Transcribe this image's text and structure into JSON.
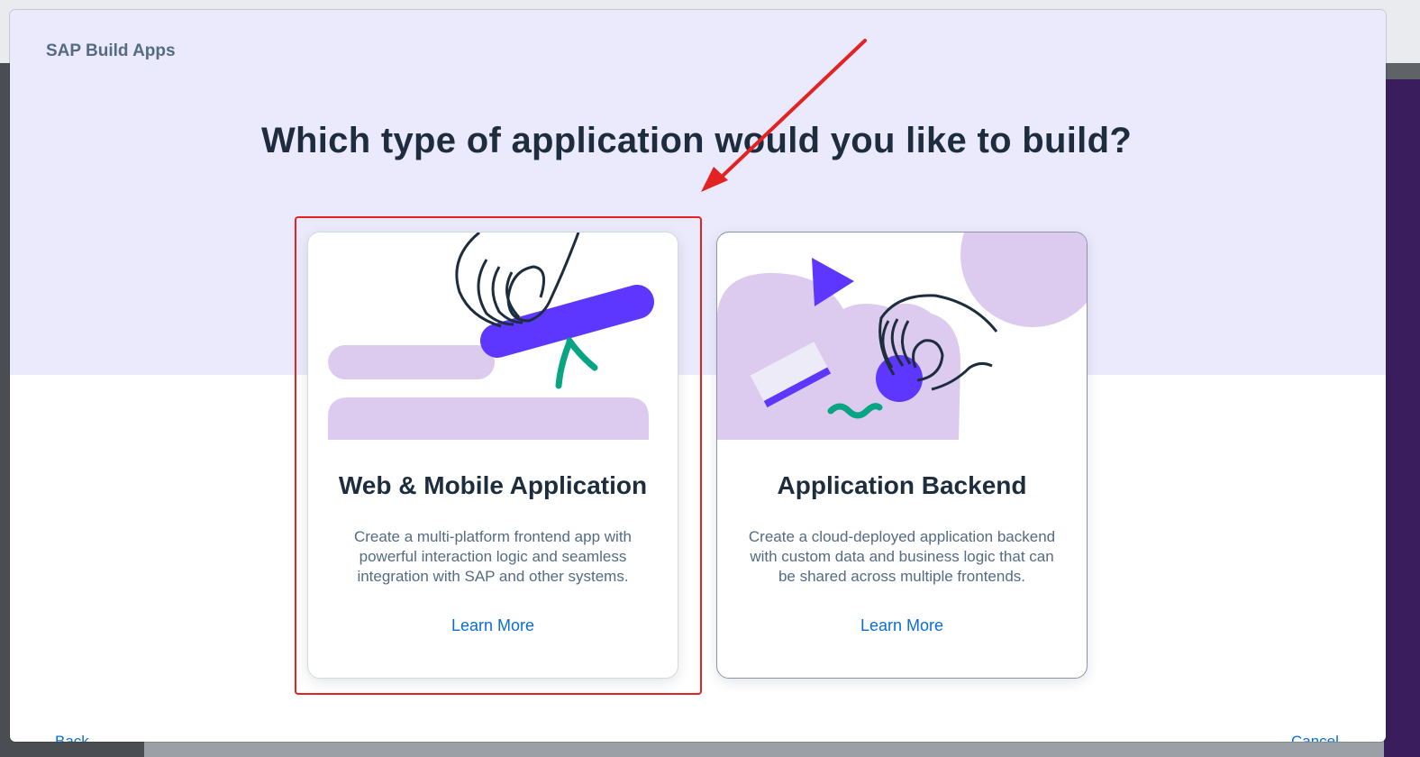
{
  "modal": {
    "brand": "SAP Build Apps",
    "question": "Which type of application would you like to build?",
    "footer": {
      "back_label": "Back",
      "cancel_label": "Cancel"
    }
  },
  "cards": [
    {
      "title": "Web & Mobile Application",
      "description": "Create a multi-platform frontend app with powerful interaction logic and seamless integration with SAP and other systems.",
      "link": "Learn More",
      "illustration_icon": "hand-grabbing-bar-icon"
    },
    {
      "title": "Application Backend",
      "description": "Create a cloud-deployed application backend with custom data and business logic that can be shared across multiple frontends.",
      "link": "Learn More",
      "illustration_icon": "hand-with-ball-icon"
    }
  ],
  "colors": {
    "hero_bg": "#ebeafc",
    "accent_purple": "#5d36ff",
    "lilac": "#dccbef",
    "teal": "#07a584",
    "link": "#0a6ed1",
    "annotation_red": "#e32222"
  }
}
